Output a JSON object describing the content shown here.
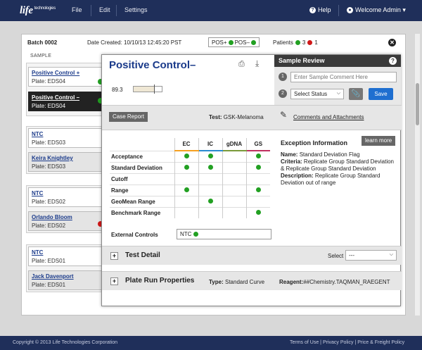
{
  "nav": {
    "logo_main": "life",
    "logo_sub": "technologies",
    "menu": [
      "File",
      "Edit",
      "Settings"
    ],
    "help_label": "Help",
    "user_label": "Welcome Admin"
  },
  "batch": {
    "label": "Batch 0002",
    "date_created": "Date Created: 10/10/13 12:45:20 PST",
    "pos_plus": "POS+",
    "pos_minus": "POS–",
    "patients_label": "Patients",
    "green_count": "3",
    "red_count": "1",
    "sample_header": "SAMPLE"
  },
  "samples": [
    {
      "name": "Positive Control +",
      "plate": "Plate: EDS04"
    },
    {
      "name": "Positive Control –",
      "plate": "Plate: EDS04"
    },
    {
      "name": "NTC",
      "plate": "Plate: EDS03"
    },
    {
      "name": "Keira Knightley",
      "plate": "Plate: EDS03"
    },
    {
      "name": "NTC",
      "plate": "Plate: EDS02"
    },
    {
      "name": "Orlando Bloom",
      "plate": "Plate: EDS02"
    },
    {
      "name": "NTC",
      "plate": "Plate: EDS01"
    },
    {
      "name": "Jack Davenport",
      "plate": "Plate: EDS01"
    }
  ],
  "detail": {
    "title": "Positive Control–",
    "temp_value": "89.3",
    "temp_fraction": 0.72,
    "case_report": "Case Report",
    "test_label": "Test:",
    "test_value": "GSK-Melanoma",
    "comments_link": "Comments and Attachments"
  },
  "review": {
    "title": "Sample Review",
    "step1": "1",
    "step2": "2",
    "comment_placeholder": "Enter Sample Comment Here",
    "status_select": "Select Status",
    "save_label": "Save"
  },
  "controls_table": {
    "columns": [
      "EC",
      "IC",
      "gDNA",
      "GS"
    ],
    "rows": [
      {
        "label": "Acceptance",
        "dots": [
          true,
          true,
          false,
          true
        ]
      },
      {
        "label": "Standard Deviation",
        "dots": [
          true,
          true,
          false,
          true
        ]
      },
      {
        "label": "Cutoff",
        "dots": [
          false,
          false,
          false,
          false
        ]
      },
      {
        "label": "Range",
        "dots": [
          true,
          false,
          false,
          true
        ]
      },
      {
        "label": "GeoMean Range",
        "dots": [
          false,
          true,
          false,
          false
        ]
      },
      {
        "label": "Benchmark Range",
        "dots": [
          false,
          false,
          false,
          true
        ]
      }
    ],
    "external_label": "External Controls",
    "external_value": "NTC"
  },
  "exception": {
    "title": "Exception Information",
    "learn_more": "learn more",
    "name_label": "Name:",
    "name_value": "Standard Deviation Flag",
    "criteria_label": "Criteria:",
    "criteria_value": "Replicate Group Standard Deviation & Replicate Group Standard Deviation",
    "description_label": "Description:",
    "description_value": "Replicate Group Standard Deviation out of range"
  },
  "test_detail": {
    "title": "Test Detail",
    "select_label": "Select",
    "select_value": "---"
  },
  "plate_run": {
    "title": "Plate Run Properties",
    "type_label": "Type:",
    "type_value": "Standard Curve",
    "reagent_label": "Reagent:",
    "reagent_value": "##Chemistry.TAQMAN_RAEGENT"
  },
  "footer": {
    "copyright": "Copyright © 2013 Life Technologies Corporation",
    "links": "Terms of Use  |  Privacy Policy  |  Price & Freight Policy"
  },
  "colors": {
    "navy": "#1f2f5a",
    "link_blue": "#1a3a8a",
    "green": "#22a022",
    "red": "#d01818",
    "save_blue": "#1f6fd0"
  }
}
